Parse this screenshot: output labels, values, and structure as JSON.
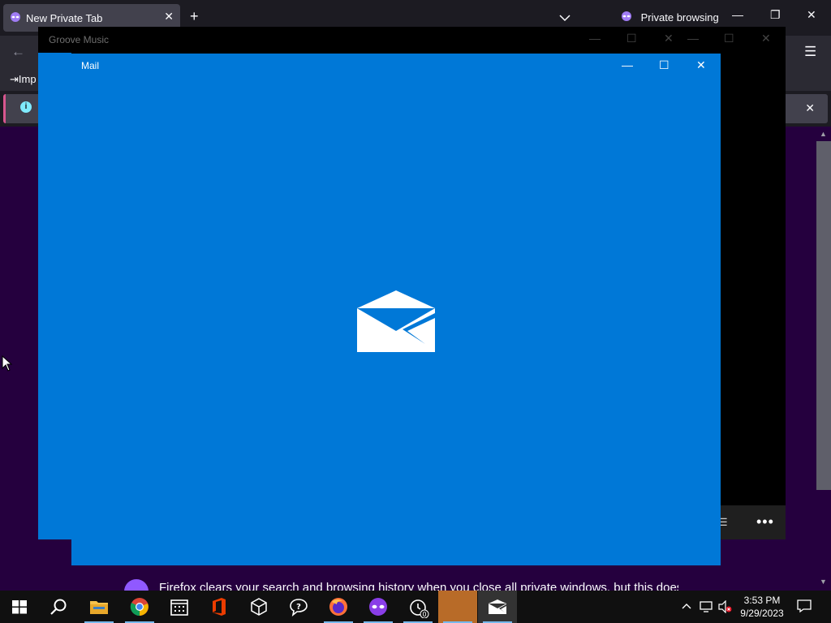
{
  "firefox": {
    "tab_title": "New Private Tab",
    "new_tab_label": "+",
    "private_label": "Private browsing",
    "import_label": "Imp",
    "notice_label": "i",
    "footer_text": "Firefox clears your search and browsing history when you close all private windows, but this doesn't"
  },
  "groove": {
    "title": "Groove Music"
  },
  "mail": {
    "title": "Mail"
  },
  "taskbar": {
    "time": "3:53 PM",
    "date": "9/29/2023",
    "alarm_badge": "0"
  },
  "colors": {
    "mail_blue": "#0078d7",
    "firefox_dark": "#1c1b22",
    "private_purple": "#25003e",
    "taskbar": "#101010"
  }
}
